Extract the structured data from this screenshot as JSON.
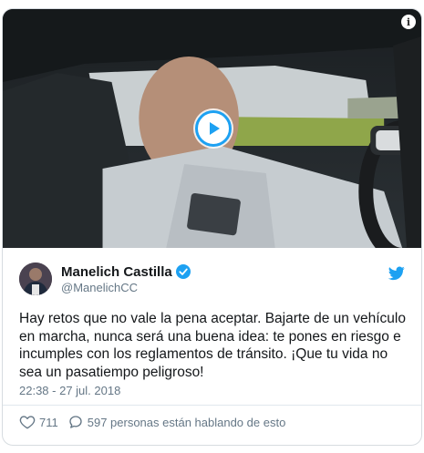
{
  "media": {
    "play_icon": "play-icon",
    "info_icon": "info-icon",
    "info_glyph": "i"
  },
  "tweet": {
    "display_name": "Manelich Castilla",
    "handle": "@ManelichCC",
    "verified_icon": "verified-badge-icon",
    "brand_icon": "twitter-bird-icon",
    "text": "Hay retos que no vale la pena aceptar. Bajarte de un vehículo en marcha, nunca será una buena idea: te pones en riesgo e incumples con los reglamentos de tránsito. ¡Que tu vida no sea un pasatiempo peligroso!",
    "timestamp": "22:38 - 27 jul. 2018",
    "likes": "711",
    "replies_text": "597 personas están hablando de esto"
  },
  "colors": {
    "accent": "#1da1f2",
    "text": "#14171a",
    "secondary": "#657786",
    "border": "#d7dce0"
  }
}
